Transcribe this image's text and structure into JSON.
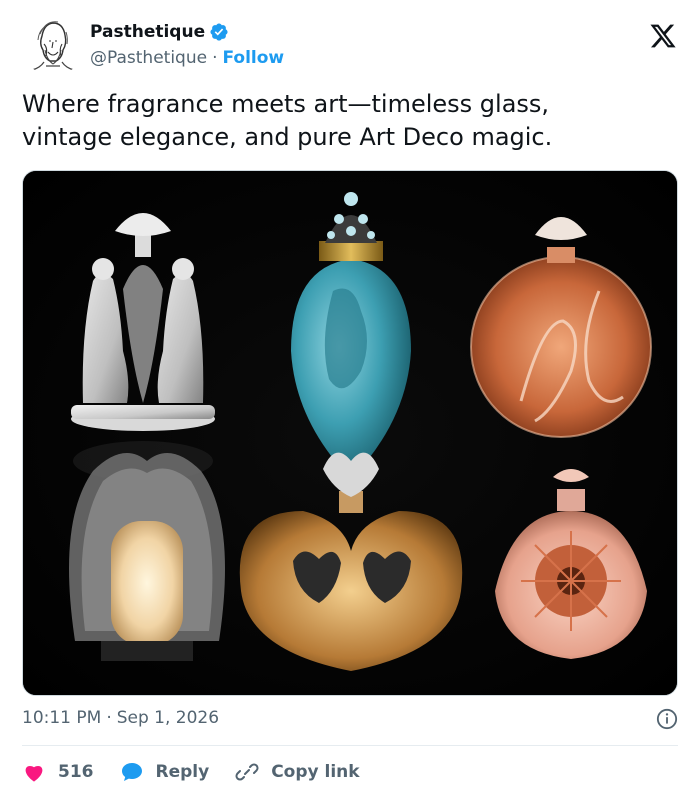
{
  "author": {
    "name": "Pasthetique",
    "handle": "@Pasthetique",
    "separator": "·",
    "follow_label": "Follow",
    "verified_color": "#1d9bf0"
  },
  "tweet": {
    "line1": "Where fragrance meets art—timeless glass,",
    "line2": "vintage elegance, and pure Art Deco magic."
  },
  "media": {
    "description_icon": "perfume-bottles-image"
  },
  "meta": {
    "time": "10:11 PM",
    "separator": "·",
    "date": "Sep 1, 2026"
  },
  "actions": {
    "like_count": "516",
    "reply_label": "Reply",
    "copy_label": "Copy link"
  },
  "colors": {
    "accent": "#1d9bf0",
    "like": "#f91880",
    "muted": "#536471"
  }
}
